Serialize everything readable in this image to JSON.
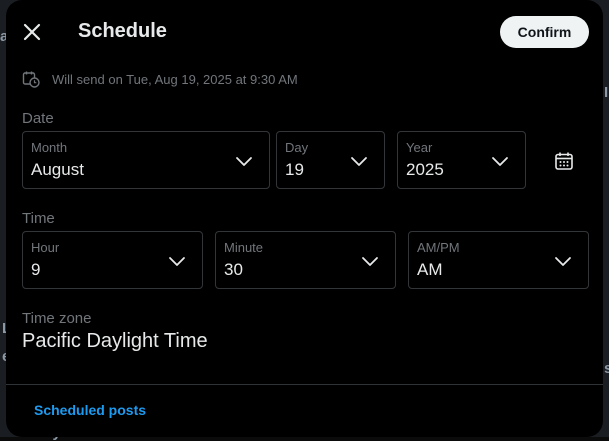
{
  "header": {
    "close_icon": "close-icon",
    "title": "Schedule",
    "confirm_label": "Confirm"
  },
  "will_send": {
    "icon": "calendar-clock-icon",
    "text": "Will send on Tue, Aug 19, 2025 at 9:30 AM"
  },
  "date": {
    "section_label": "Date",
    "month": {
      "label": "Month",
      "value": "August"
    },
    "day": {
      "label": "Day",
      "value": "19"
    },
    "year": {
      "label": "Year",
      "value": "2025"
    },
    "calendar_icon": "calendar-icon"
  },
  "time": {
    "section_label": "Time",
    "hour": {
      "label": "Hour",
      "value": "9"
    },
    "minute": {
      "label": "Minute",
      "value": "30"
    },
    "ampm": {
      "label": "AM/PM",
      "value": "AM"
    }
  },
  "timezone": {
    "label": "Time zone",
    "value": "Pacific Daylight Time"
  },
  "footer": {
    "scheduled_posts_link": "Scheduled posts"
  },
  "colors": {
    "modal_bg": "#000000",
    "text_primary": "#e7e9ea",
    "text_secondary": "#71767b",
    "border": "#333639",
    "accent": "#1d9bf0",
    "confirm_bg": "#eff3f4"
  }
}
